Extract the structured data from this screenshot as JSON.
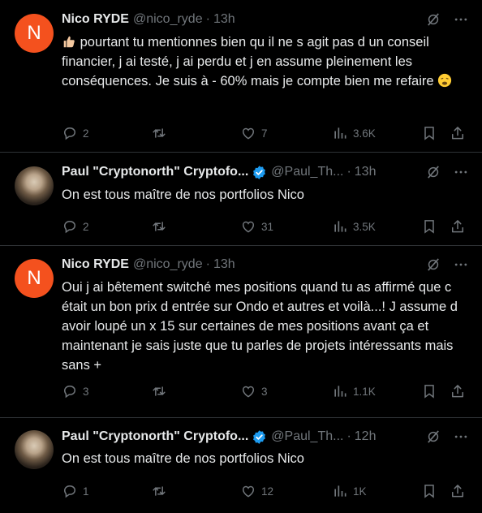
{
  "tweets": [
    {
      "author_name": "Nico RYDE",
      "handle": "@nico_ryde",
      "time": "13h",
      "avatar_letter": "N",
      "text": "pourtant tu mentionnes bien qu il ne s agit pas d un conseil financier, j ai testé, j ai perdu et j en assume pleinement les conséquences. Je suis à - 60% mais je compte bien me refaire",
      "replies": "2",
      "retweets": "",
      "likes": "7",
      "views": "3.6K"
    },
    {
      "author_name": "Paul \"Cryptonorth\" Cryptofo...",
      "handle": "@Paul_Th...",
      "time": "13h",
      "text": "On est tous maître de nos portfolios Nico",
      "replies": "2",
      "retweets": "",
      "likes": "31",
      "views": "3.5K"
    },
    {
      "author_name": "Nico RYDE",
      "handle": "@nico_ryde",
      "time": "13h",
      "avatar_letter": "N",
      "text": "Oui j ai bêtement switché mes positions quand tu as affirmé que c était un bon prix d entrée sur Ondo et autres et voilà...! J assume d avoir loupé un x 15 sur certaines de mes positions avant ça et maintenant je sais juste que tu parles de projets intéressants mais sans +",
      "replies": "3",
      "retweets": "",
      "likes": "3",
      "views": "1.1K"
    },
    {
      "author_name": "Paul \"Cryptonorth\" Cryptofo...",
      "handle": "@Paul_Th...",
      "time": "12h",
      "text": "On est tous maître de nos portfolios Nico",
      "replies": "1",
      "retweets": "",
      "likes": "12",
      "views": "1K"
    }
  ],
  "colors": {
    "background": "#000000",
    "text": "#e7e9ea",
    "muted": "#71767b",
    "verified": "#1d9bf0",
    "avatar_n": "#f4511e"
  },
  "icons": [
    "reply-icon",
    "retweet-icon",
    "like-icon",
    "views-icon",
    "bookmark-icon",
    "share-icon",
    "grok-icon",
    "more-icon",
    "verified-badge-icon",
    "thumbs-up-emoji",
    "weary-face-emoji"
  ]
}
